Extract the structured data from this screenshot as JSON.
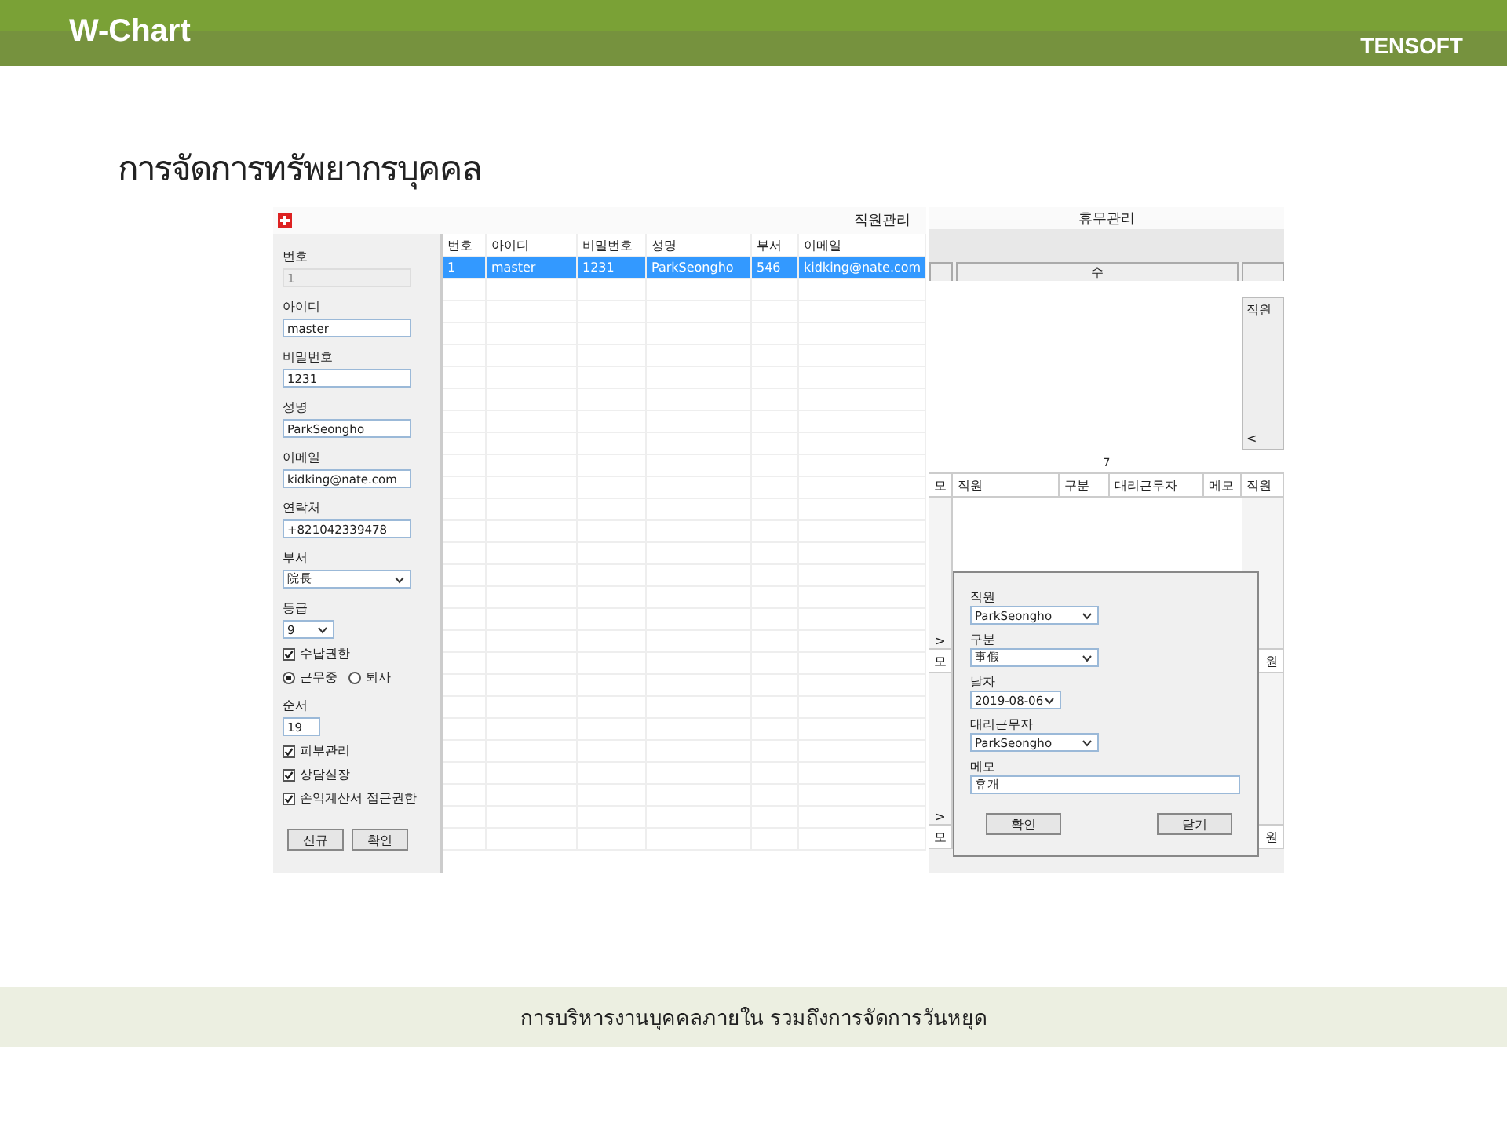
{
  "header": {
    "title": "W-Chart",
    "brand": "TENSOFT"
  },
  "heading": "การจัดการทรัพยากรบุคคล",
  "staff_window": {
    "title": "직원관리",
    "form": [
      {
        "kind": "readonly",
        "label": "번호",
        "value": "1"
      },
      {
        "kind": "text",
        "label": "아이디",
        "value": "master"
      },
      {
        "kind": "text",
        "label": "비밀번호",
        "value": "1231"
      },
      {
        "kind": "text",
        "label": "성명",
        "value": "ParkSeongho"
      },
      {
        "kind": "text",
        "label": "이메일",
        "value": "kidking@nate.com"
      },
      {
        "kind": "text",
        "label": "연락처",
        "value": "+821042339478"
      },
      {
        "kind": "select",
        "label": "부서",
        "value": "院長"
      },
      {
        "kind": "small_select",
        "label": "등급",
        "value": "9"
      },
      {
        "kind": "checkbox",
        "label": "수납권한",
        "checked": true
      },
      {
        "kind": "radio",
        "options": [
          {
            "label": "근무중",
            "selected": true
          },
          {
            "label": "퇴사",
            "selected": false
          }
        ]
      },
      {
        "kind": "short",
        "label": "순서",
        "value": "19"
      },
      {
        "kind": "checkbox",
        "label": "피부관리",
        "checked": true
      },
      {
        "kind": "checkbox",
        "label": "상담실장",
        "checked": true
      },
      {
        "kind": "checkbox",
        "label": "손익계산서 접근권한",
        "checked": true
      }
    ],
    "buttons": [
      "신규",
      "확인"
    ],
    "table": {
      "columns": [
        "번호",
        "아이디",
        "비밀번호",
        "성명",
        "부서",
        "이메일"
      ],
      "rows": [
        {
          "selected": true,
          "cells": [
            "1",
            "master",
            "1231",
            "ParkSeongho",
            "546",
            "kidking@nate.com"
          ]
        }
      ]
    }
  },
  "leave_window": {
    "title": "휴무관리",
    "weekday": "수",
    "side_panel": "직원",
    "side_panel_arrow": "<",
    "day": "7",
    "header_cells": [
      "모",
      "직원",
      "구분",
      "대리근무자",
      "메모",
      "직원"
    ],
    "sections": [
      {
        "arrow": ">",
        "left": "모",
        "right": "원"
      },
      {
        "arrow": ">",
        "left": "모",
        "right": "원"
      }
    ],
    "dialog": {
      "fields": [
        {
          "kind": "select",
          "label": "직원",
          "value": "ParkSeongho"
        },
        {
          "kind": "select",
          "label": "구분",
          "value": "事假"
        },
        {
          "kind": "date",
          "label": "날자",
          "value": "2019-08-06"
        },
        {
          "kind": "select",
          "label": "대리근무자",
          "value": "ParkSeongho"
        },
        {
          "kind": "text",
          "label": "메모",
          "value": "휴개"
        }
      ],
      "buttons": [
        "확인",
        "닫기"
      ]
    }
  },
  "caption": "การบริหารงานบุคคลภายใน รวมถึงการจัดการวันหยุด"
}
